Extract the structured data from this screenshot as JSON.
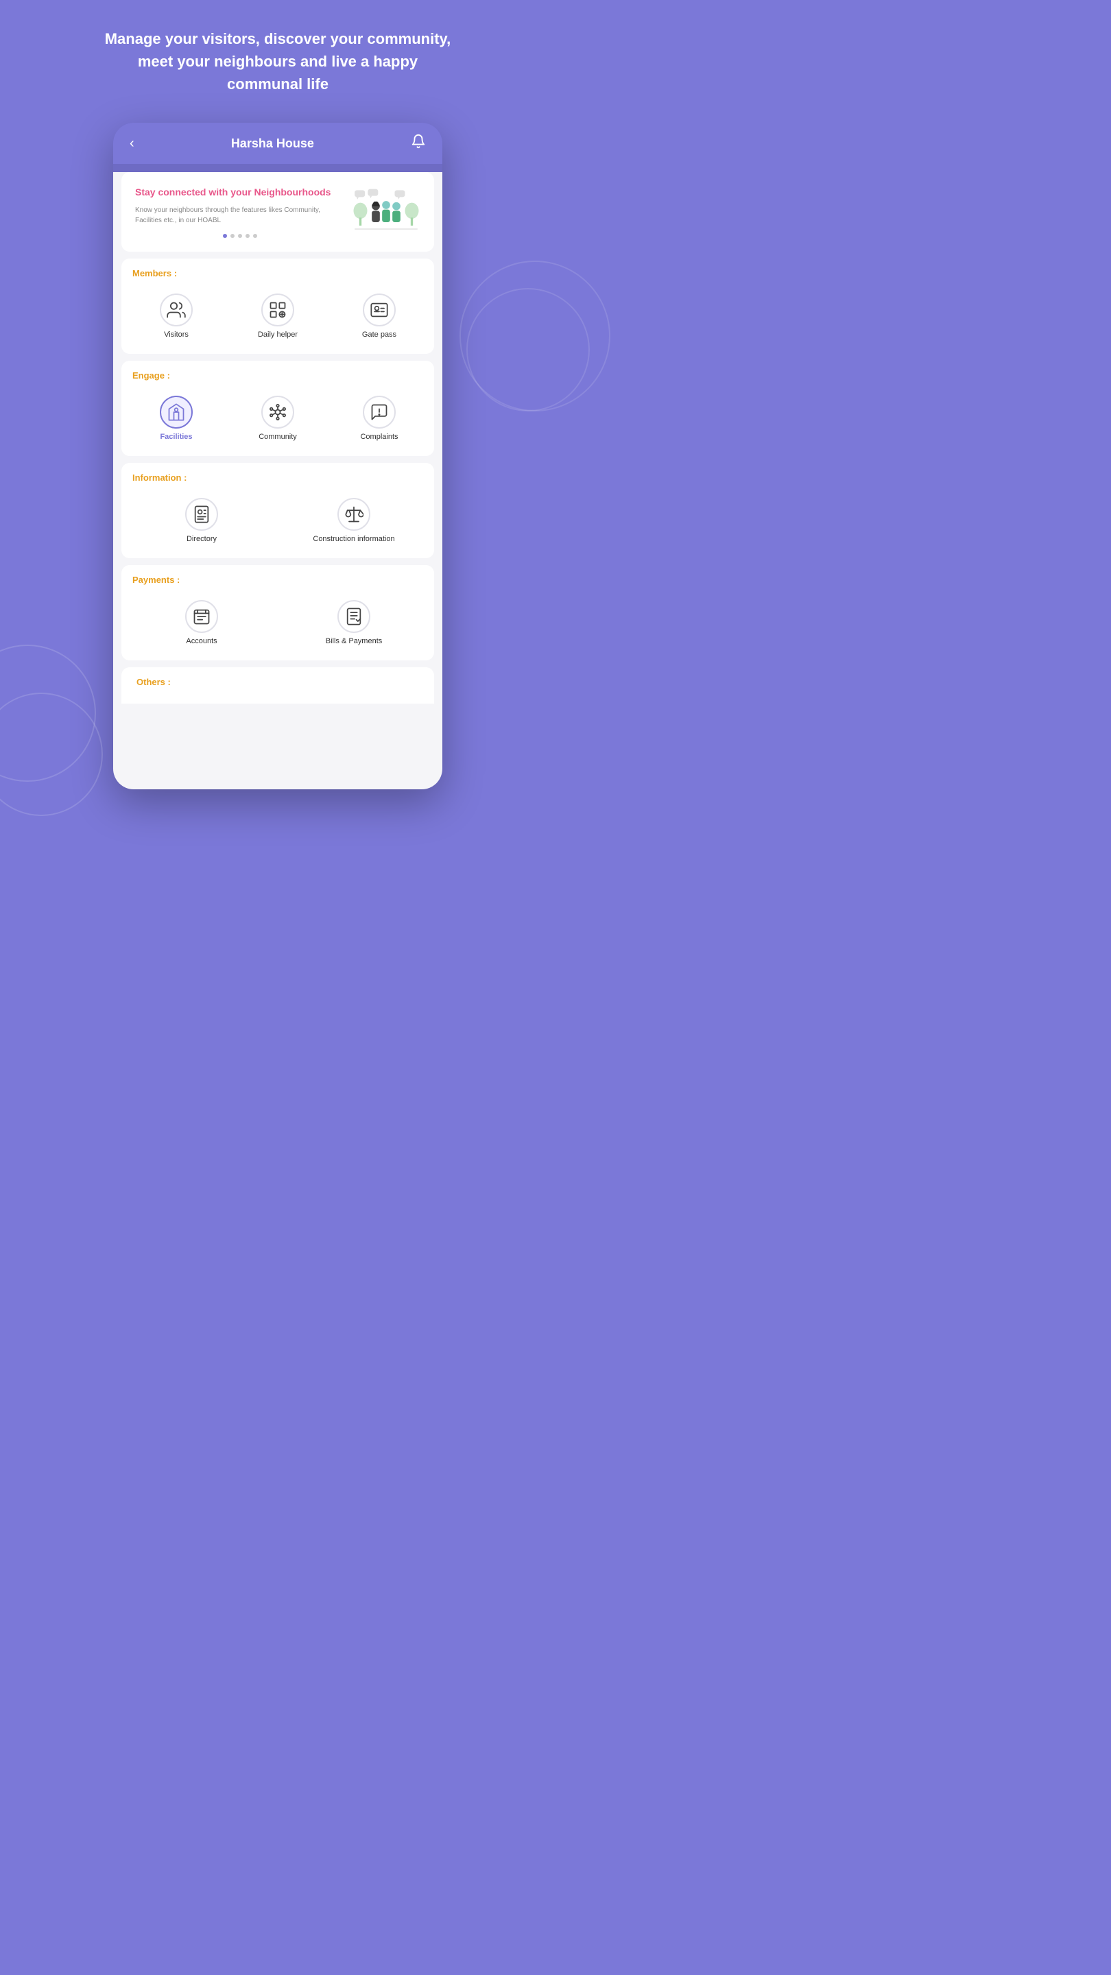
{
  "background_color": "#7b78d8",
  "headline": "Manage your visitors, discover your community, meet your neighbours and live a happy communal life",
  "phone": {
    "header": {
      "back_icon": "‹",
      "title": "Harsha House",
      "bell_icon": "🔔"
    },
    "banner": {
      "title": "Stay connected with your Neighbourhoods",
      "description": "Know your neighbours through the features likes Community, Facilities etc., in our HOABL",
      "dots": [
        true,
        false,
        false,
        false,
        false
      ]
    },
    "sections": [
      {
        "id": "members",
        "title": "Members :",
        "columns": 3,
        "items": [
          {
            "id": "visitors",
            "label": "Visitors",
            "active": false
          },
          {
            "id": "daily-helper",
            "label": "Daily helper",
            "active": false
          },
          {
            "id": "gate-pass",
            "label": "Gate pass",
            "active": false
          }
        ]
      },
      {
        "id": "engage",
        "title": "Engage :",
        "columns": 3,
        "items": [
          {
            "id": "facilities",
            "label": "Facilities",
            "active": true
          },
          {
            "id": "community",
            "label": "Community",
            "active": false
          },
          {
            "id": "complaints",
            "label": "Complaints",
            "active": false
          }
        ]
      },
      {
        "id": "information",
        "title": "Information :",
        "columns": 2,
        "items": [
          {
            "id": "directory",
            "label": "Directory",
            "active": false
          },
          {
            "id": "construction-information",
            "label": "Construction information",
            "active": false
          }
        ]
      },
      {
        "id": "payments",
        "title": "Payments :",
        "columns": 2,
        "items": [
          {
            "id": "accounts",
            "label": "Accounts",
            "active": false
          },
          {
            "id": "bills-payments",
            "label": "Bills & Payments",
            "active": false
          }
        ]
      }
    ],
    "others_title": "Others :"
  }
}
